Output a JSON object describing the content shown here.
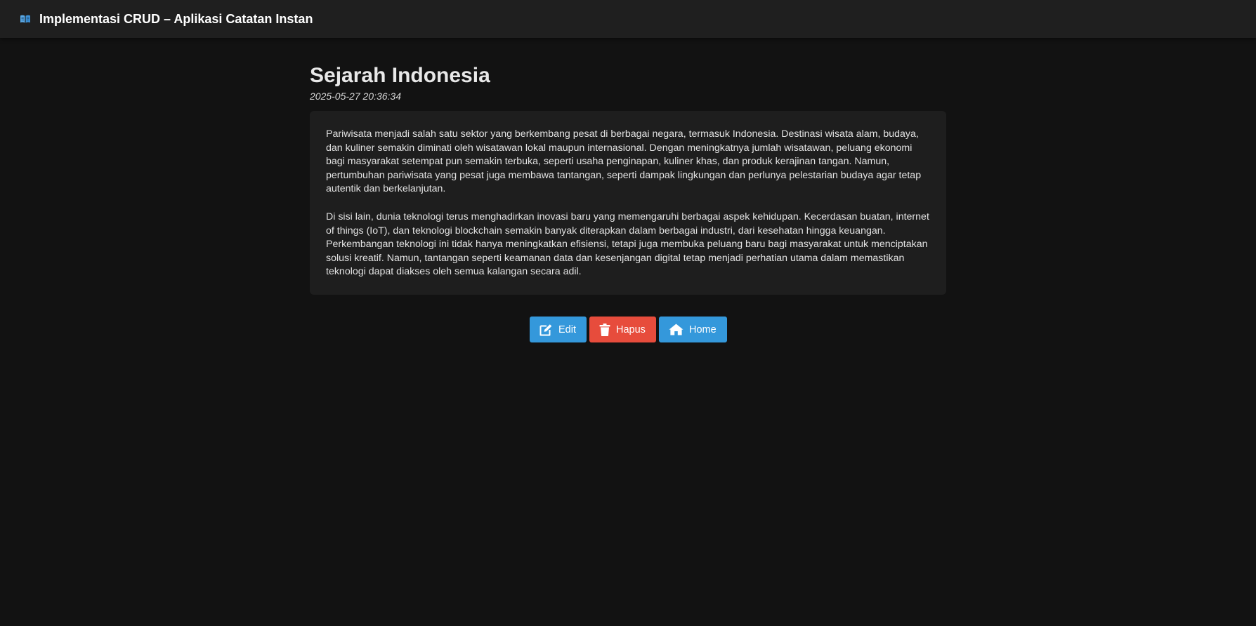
{
  "header": {
    "title": "Implementasi CRUD – Aplikasi Catatan Instan",
    "icon": "open-book-icon"
  },
  "note": {
    "title": "Sejarah Indonesia",
    "date": "2025-05-27 20:36:34",
    "paragraphs": [
      "Pariwisata menjadi salah satu sektor yang berkembang pesat di berbagai negara, termasuk Indonesia. Destinasi wisata alam, budaya, dan kuliner semakin diminati oleh wisatawan lokal maupun internasional. Dengan meningkatnya jumlah wisatawan, peluang ekonomi bagi masyarakat setempat pun semakin terbuka, seperti usaha penginapan, kuliner khas, dan produk kerajinan tangan. Namun, pertumbuhan pariwisata yang pesat juga membawa tantangan, seperti dampak lingkungan dan perlunya pelestarian budaya agar tetap autentik dan berkelanjutan.",
      "Di sisi lain, dunia teknologi terus menghadirkan inovasi baru yang memengaruhi berbagai aspek kehidupan. Kecerdasan buatan, internet of things (IoT), dan teknologi blockchain semakin banyak diterapkan dalam berbagai industri, dari kesehatan hingga keuangan. Perkembangan teknologi ini tidak hanya meningkatkan efisiensi, tetapi juga membuka peluang baru bagi masyarakat untuk menciptakan solusi kreatif. Namun, tantangan seperti keamanan data dan kesenjangan digital tetap menjadi perhatian utama dalam memastikan teknologi dapat diakses oleh semua kalangan secara adil."
    ]
  },
  "actions": {
    "edit_label": "Edit",
    "delete_label": "Hapus",
    "home_label": "Home",
    "edit_icon": "edit-icon",
    "delete_icon": "trash-icon",
    "home_icon": "home-icon"
  },
  "colors": {
    "background": "#121212",
    "topbar": "#1f1f1f",
    "card": "#1e1e1e",
    "primary": "#3498db",
    "danger": "#e74c3c"
  }
}
